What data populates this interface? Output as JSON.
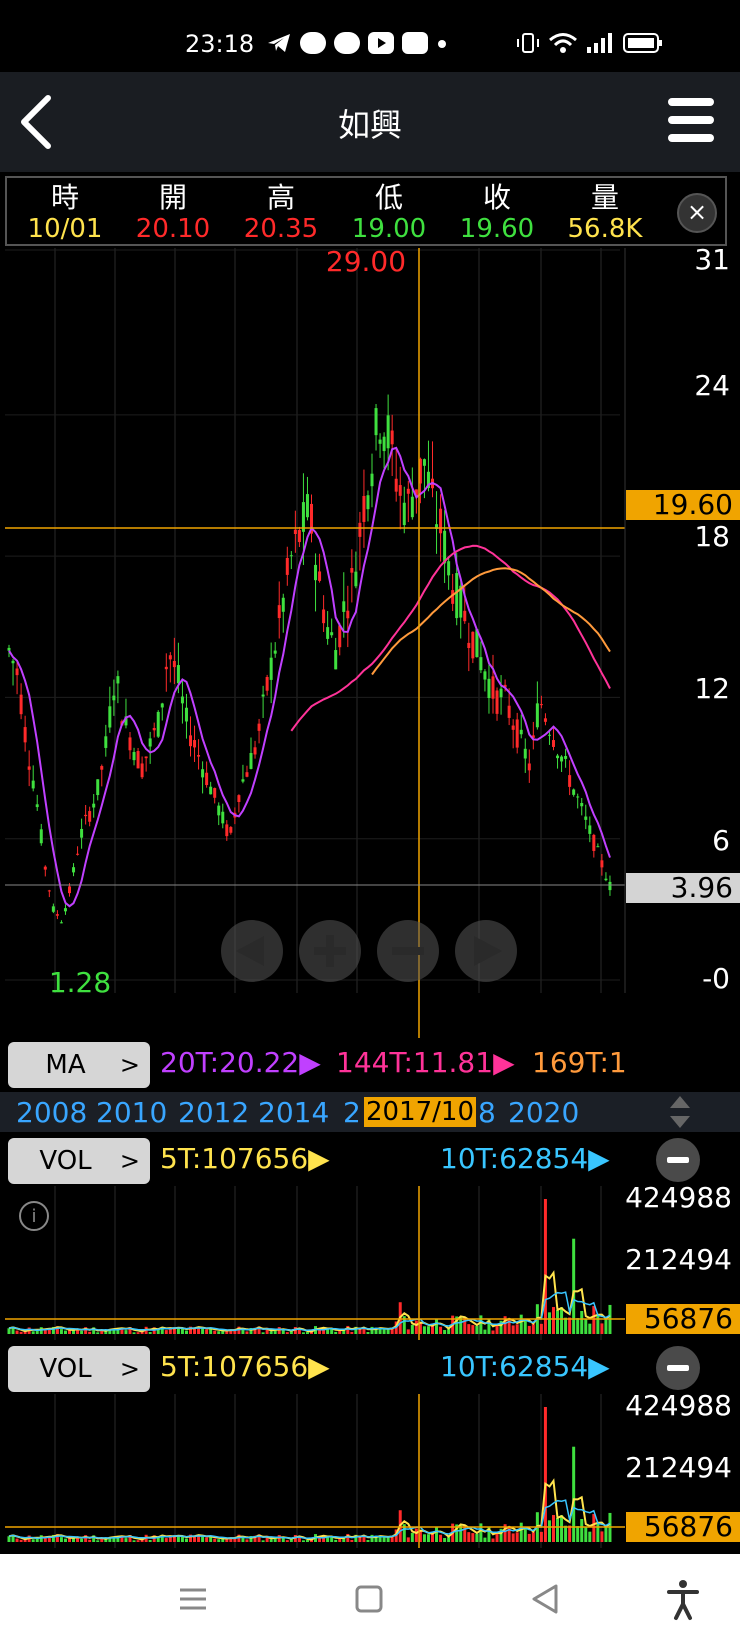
{
  "status_bar": {
    "time": "23:18"
  },
  "nav": {
    "title": "如興"
  },
  "ohlc": {
    "labels": {
      "time": "時",
      "open": "開",
      "high": "高",
      "low": "低",
      "close": "收",
      "volume": "量"
    },
    "values": {
      "time": "10/01",
      "open": "20.10",
      "high": "20.35",
      "low": "19.00",
      "close": "19.60",
      "volume": "56.8K"
    },
    "close_icon": "×"
  },
  "colors": {
    "up": "#ff2a2a",
    "down": "#3fe03f",
    "time": "#ffe34d",
    "vol": "#ffe34d",
    "accent": "#f0a400",
    "blue": "#39a6ff"
  },
  "main_axis": {
    "ticks": [
      "31",
      "24",
      "18",
      "12",
      "6",
      "-0"
    ],
    "current_price": "19.60",
    "last_price": "3.96",
    "max_label": "29.00",
    "min_label": "1.28"
  },
  "ma": {
    "button_label": "MA",
    "ma20": "20T:20.22",
    "ma144": "144T:11.81",
    "ma169": "169T:1"
  },
  "years": {
    "left_labels": [
      "2008",
      "2010",
      "2012",
      "2014",
      "2"
    ],
    "current": "2017/10",
    "right_labels": [
      "8",
      "2020"
    ]
  },
  "vol_panel_1": {
    "button_label": "VOL",
    "ma5": "5T:107656",
    "ma10": "10T:62854",
    "ticks": [
      "424988",
      "212494"
    ],
    "current": "56876"
  },
  "vol_panel_2": {
    "button_label": "VOL",
    "ma5": "5T:107656",
    "ma10": "10T:62854",
    "ticks": [
      "424988",
      "212494"
    ],
    "current": "56876"
  },
  "chart_data": {
    "type": "candlestick",
    "price_axis_ticks": [
      31,
      24,
      18,
      12,
      6,
      0
    ],
    "price_range": [
      0,
      31
    ],
    "current_price": 19.6,
    "last_price": 3.96,
    "max_price": 29.0,
    "min_price": 1.28,
    "year_ticks": [
      "2008",
      "2010",
      "2012",
      "2014",
      "2017/10",
      "2020"
    ],
    "ma_lines": [
      {
        "name": "20T",
        "value": 20.22
      },
      {
        "name": "144T",
        "value": 11.81
      }
    ],
    "volume_axis_ticks": [
      424988,
      212494
    ],
    "volume_current": 56876,
    "volume_ma": [
      {
        "name": "5T",
        "value": 107656
      },
      {
        "name": "10T",
        "value": 62854
      }
    ],
    "approx_monthly_close": [
      14,
      13,
      10,
      8,
      5,
      3,
      2.5,
      4,
      6,
      7,
      8,
      10,
      13,
      11,
      10,
      9,
      10,
      11,
      14,
      13,
      11,
      10,
      9,
      8,
      7,
      6,
      8,
      9,
      10,
      12,
      14,
      16,
      18,
      19,
      20,
      17,
      15,
      14,
      16,
      17,
      20,
      22,
      24,
      23,
      21,
      20,
      21,
      22,
      20,
      19,
      17,
      16,
      15,
      14,
      13,
      12,
      12,
      11,
      10,
      9,
      12,
      11,
      10,
      9,
      8,
      7,
      6,
      5,
      4
    ]
  }
}
